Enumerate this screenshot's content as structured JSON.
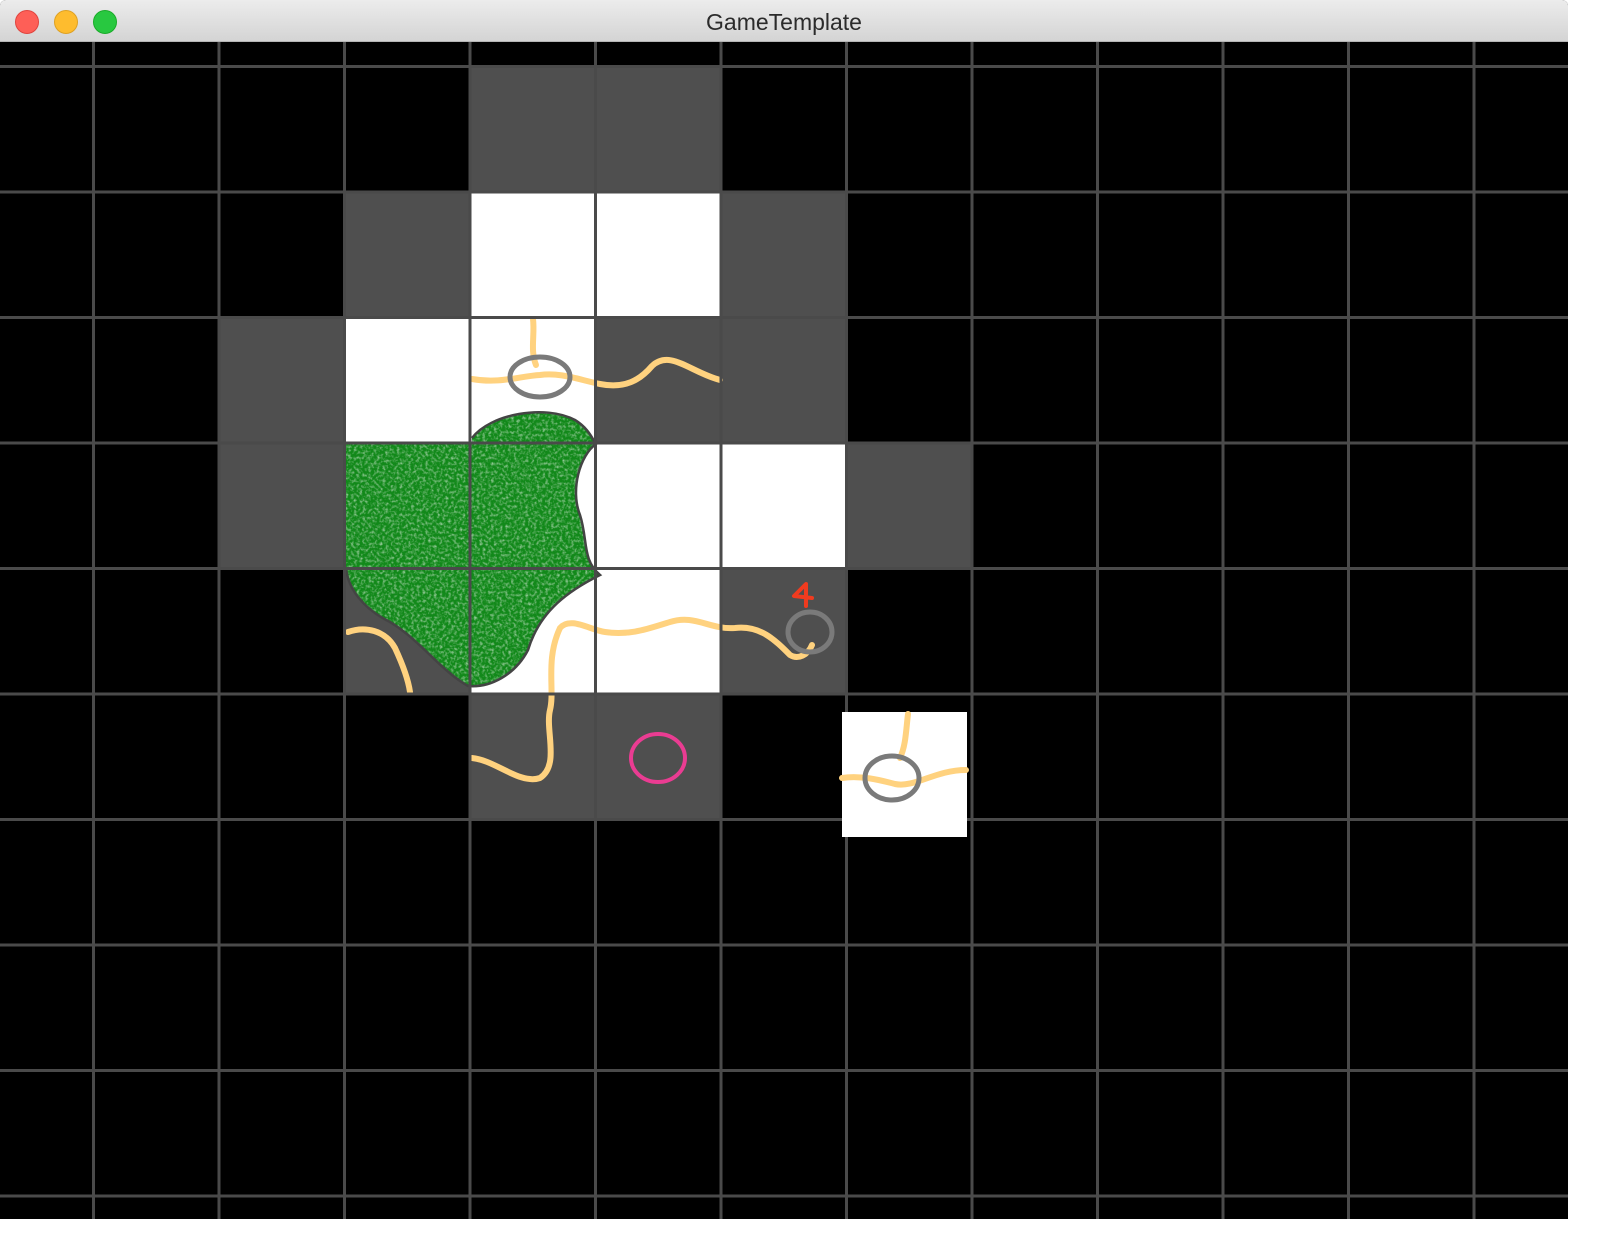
{
  "window": {
    "title": "GameTemplate",
    "controls": [
      "close",
      "minimize",
      "zoom"
    ]
  },
  "game": {
    "colors": {
      "background": "#000000",
      "grid_line": "#4a4a4a",
      "fog_tile": "#4f4f4f",
      "revealed_tile": "#ffffff",
      "road": "#ffd27f",
      "ring": "#7a7a7a",
      "forest": "#12891a",
      "forest_outline": "#444444",
      "flag": "#f03b1f",
      "marker": "#ea3c92"
    },
    "fog_tiles": [
      {
        "col": 4,
        "row": 1
      },
      {
        "col": 5,
        "row": 1
      },
      {
        "col": 3,
        "row": 2
      },
      {
        "col": 6,
        "row": 2
      },
      {
        "col": 2,
        "row": 3
      },
      {
        "col": 5,
        "row": 3
      },
      {
        "col": 6,
        "row": 3
      },
      {
        "col": 2,
        "row": 4
      },
      {
        "col": 7,
        "row": 4
      },
      {
        "col": 3,
        "row": 5
      },
      {
        "col": 6,
        "row": 5
      },
      {
        "col": 4,
        "row": 6
      },
      {
        "col": 5,
        "row": 6
      }
    ],
    "revealed_tiles": [
      {
        "col": 4,
        "row": 2,
        "contents": "road-with-ring"
      },
      {
        "col": 5,
        "row": 2,
        "contents": "road"
      },
      {
        "col": 3,
        "row": 3,
        "contents": "forest"
      },
      {
        "col": 4,
        "row": 3,
        "contents": "forest"
      },
      {
        "col": 3,
        "row": 4,
        "contents": "forest-and-road"
      },
      {
        "col": 4,
        "row": 4,
        "contents": "forest-and-road"
      },
      {
        "col": 5,
        "row": 4,
        "contents": "road"
      },
      {
        "col": 6,
        "row": 4,
        "contents": "road-with-ring-and-flag"
      },
      {
        "col": 4,
        "row": 5,
        "contents": "road"
      },
      {
        "col": 5,
        "row": 5,
        "contents": "marker"
      }
    ],
    "held_tile": {
      "contents": "road-with-ring"
    }
  }
}
